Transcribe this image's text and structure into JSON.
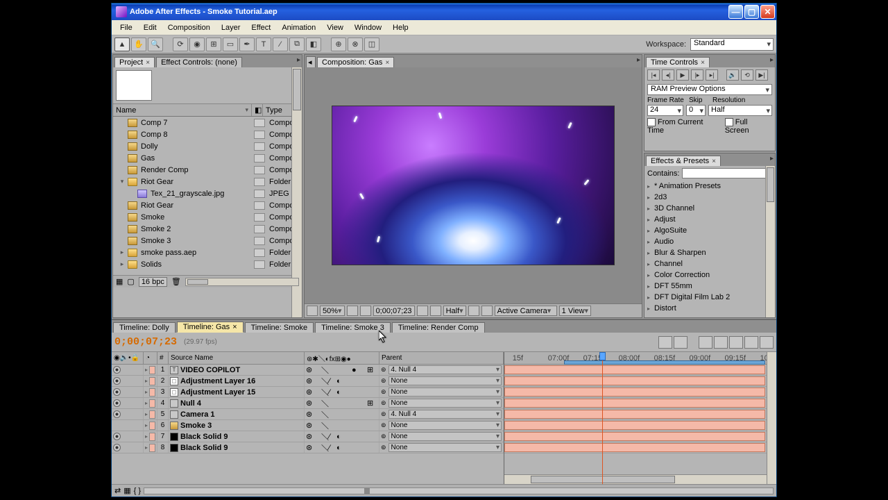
{
  "window": {
    "title": "Adobe After Effects - Smoke Tutorial.aep"
  },
  "menu": [
    "File",
    "Edit",
    "Composition",
    "Layer",
    "Effect",
    "Animation",
    "View",
    "Window",
    "Help"
  ],
  "workspace": {
    "label": "Workspace:",
    "selected": "Standard"
  },
  "project_panel": {
    "tabs": [
      {
        "label": "Project",
        "closable": true,
        "active": true
      },
      {
        "label": "Effect Controls: (none)",
        "closable": false,
        "active": false
      }
    ],
    "columns": {
      "name": "Name",
      "type": "Type"
    },
    "items": [
      {
        "indent": 0,
        "disclose": "",
        "icon": "comp",
        "name": "Comp 7",
        "type": "Compo"
      },
      {
        "indent": 0,
        "disclose": "",
        "icon": "comp",
        "name": "Comp 8",
        "type": "Compo"
      },
      {
        "indent": 0,
        "disclose": "",
        "icon": "comp",
        "name": "Dolly",
        "type": "Compo"
      },
      {
        "indent": 0,
        "disclose": "",
        "icon": "comp",
        "name": "Gas",
        "type": "Compo"
      },
      {
        "indent": 0,
        "disclose": "",
        "icon": "comp",
        "name": "Render Comp",
        "type": "Compo"
      },
      {
        "indent": 0,
        "disclose": "▾",
        "icon": "folder",
        "name": "Riot Gear",
        "type": "Folder"
      },
      {
        "indent": 1,
        "disclose": "",
        "icon": "jpeg",
        "name": "Tex_21_grayscale.jpg",
        "type": "JPEG"
      },
      {
        "indent": 0,
        "disclose": "",
        "icon": "comp",
        "name": "Riot Gear",
        "type": "Compo"
      },
      {
        "indent": 0,
        "disclose": "",
        "icon": "comp",
        "name": "Smoke",
        "type": "Compo"
      },
      {
        "indent": 0,
        "disclose": "",
        "icon": "comp",
        "name": "Smoke 2",
        "type": "Compo"
      },
      {
        "indent": 0,
        "disclose": "",
        "icon": "comp",
        "name": "Smoke 3",
        "type": "Compo"
      },
      {
        "indent": 0,
        "disclose": "▸",
        "icon": "folder",
        "name": "smoke pass.aep",
        "type": "Folder"
      },
      {
        "indent": 0,
        "disclose": "▸",
        "icon": "folder",
        "name": "Solids",
        "type": "Folder"
      }
    ],
    "bpc": "16 bpc"
  },
  "comp_panel": {
    "tab": "Composition: Gas",
    "footer": {
      "zoom": "50%",
      "time": "0;00;07;23",
      "res": "Half",
      "view3d": "Active Camera",
      "views": "1 View"
    }
  },
  "time_controls": {
    "title": "Time Controls",
    "ram_label": "RAM Preview Options",
    "headers": {
      "fr": "Frame Rate",
      "skip": "Skip",
      "res": "Resolution"
    },
    "values": {
      "fr": "24",
      "skip": "0",
      "res": "Half"
    },
    "checks": {
      "fct": "From Current Time",
      "fs": "Full Screen"
    }
  },
  "effects_presets": {
    "title": "Effects & Presets",
    "contains": "Contains:",
    "search_placeholder": "",
    "cats": [
      "* Animation Presets",
      "2d3",
      "3D Channel",
      "Adjust",
      "AlgoSuite",
      "Audio",
      "Blur & Sharpen",
      "Channel",
      "Color Correction",
      "DFT 55mm",
      "DFT Digital Film Lab 2",
      "Distort"
    ]
  },
  "timeline": {
    "tabs": [
      {
        "label": "Timeline: Dolly",
        "active": false
      },
      {
        "label": "Timeline: Gas",
        "active": true,
        "closable": true
      },
      {
        "label": "Timeline: Smoke",
        "active": false
      },
      {
        "label": "Timeline: Smoke 3",
        "active": false
      },
      {
        "label": "Timeline: Render Comp",
        "active": false
      }
    ],
    "time": "0;00;07;23",
    "fps": "(29.97 fps)",
    "cols": {
      "num": "#",
      "source": "Source Name",
      "parent": "Parent"
    },
    "ruler_ticks": [
      "15f",
      "07:00f",
      "07:15f",
      "08:00f",
      "08:15f",
      "09:00f",
      "09:15f",
      "10:"
    ],
    "layers": [
      {
        "vis": true,
        "color": "#f5b9a8",
        "num": "1",
        "icon": "text",
        "name": "VIDEO COPILOT",
        "parent": "4. Null 4",
        "switches": "mb3d"
      },
      {
        "vis": true,
        "color": "#f5b9a8",
        "num": "2",
        "icon": "adj",
        "name": "Adjustment Layer 16",
        "parent": "None",
        "switches": "fx"
      },
      {
        "vis": true,
        "color": "#f5b9a8",
        "num": "3",
        "icon": "adj",
        "name": "Adjustment Layer 15",
        "parent": "None",
        "switches": "fx"
      },
      {
        "vis": true,
        "color": "#f5b9a8",
        "num": "4",
        "icon": "null",
        "name": "Null 4",
        "parent": "None",
        "switches": "3d"
      },
      {
        "vis": true,
        "color": "#f5b9a8",
        "num": "5",
        "icon": "cam",
        "name": "Camera 1",
        "parent": "4. Null 4",
        "switches": ""
      },
      {
        "vis": false,
        "color": "#f5b9a8",
        "num": "6",
        "icon": "comp",
        "name": "Smoke 3",
        "parent": "None",
        "switches": ""
      },
      {
        "vis": true,
        "color": "#f5b9a8",
        "num": "7",
        "icon": "solid",
        "name": "Black Solid 9",
        "parent": "None",
        "switches": "fx"
      },
      {
        "vis": true,
        "color": "#f5b9a8",
        "num": "8",
        "icon": "solid",
        "name": "Black Solid 9",
        "parent": "None",
        "switches": "fx"
      }
    ]
  }
}
